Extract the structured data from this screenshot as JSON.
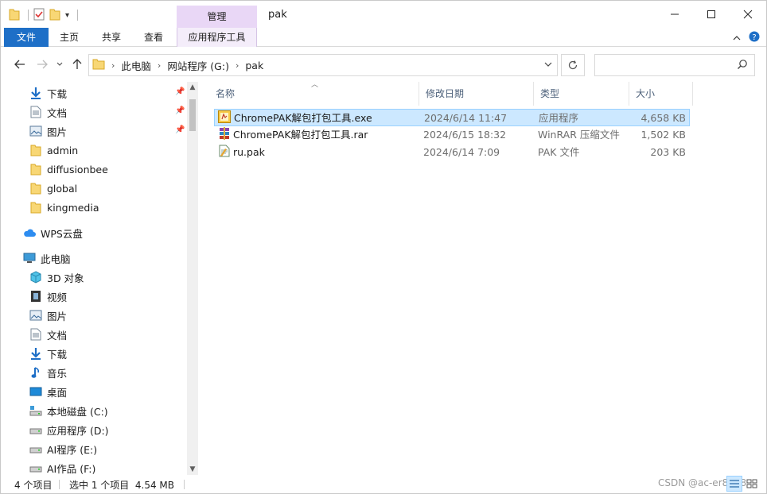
{
  "window": {
    "title": "pak"
  },
  "ribbon": {
    "context_group": "管理",
    "tabs": [
      "文件",
      "主页",
      "共享",
      "查看",
      "应用程序工具"
    ]
  },
  "address": {
    "breadcrumbs": [
      "此电脑",
      "网站程序 (G:)",
      "pak"
    ],
    "search_placeholder": ""
  },
  "nav": {
    "quick_access": [
      {
        "label": "下载",
        "icon": "download-icon",
        "pinned": true
      },
      {
        "label": "文档",
        "icon": "document-icon",
        "pinned": true
      },
      {
        "label": "图片",
        "icon": "picture-icon",
        "pinned": true
      },
      {
        "label": "admin",
        "icon": "folder-icon",
        "pinned": false
      },
      {
        "label": "diffusionbee",
        "icon": "folder-icon",
        "pinned": false
      },
      {
        "label": "global",
        "icon": "folder-icon",
        "pinned": false
      },
      {
        "label": "kingmedia",
        "icon": "folder-icon",
        "pinned": false
      }
    ],
    "wps": "WPS云盘",
    "this_pc": "此电脑",
    "pc_items": [
      {
        "label": "3D 对象",
        "icon": "cube-icon"
      },
      {
        "label": "视频",
        "icon": "video-icon"
      },
      {
        "label": "图片",
        "icon": "picture-icon"
      },
      {
        "label": "文档",
        "icon": "document-icon"
      },
      {
        "label": "下载",
        "icon": "download-icon"
      },
      {
        "label": "音乐",
        "icon": "music-icon"
      },
      {
        "label": "桌面",
        "icon": "desktop-icon"
      },
      {
        "label": "本地磁盘 (C:)",
        "icon": "system-drive-icon"
      },
      {
        "label": "应用程序 (D:)",
        "icon": "drive-icon"
      },
      {
        "label": "AI程序 (E:)",
        "icon": "drive-icon"
      },
      {
        "label": "AI作品 (F:)",
        "icon": "drive-icon"
      }
    ]
  },
  "columns": [
    "名称",
    "修改日期",
    "类型",
    "大小"
  ],
  "files": [
    {
      "name": "ChromePAK解包打包工具.exe",
      "date": "2024/6/14 11:47",
      "type": "应用程序",
      "size": "4,658 KB",
      "icon": "exe-icon",
      "selected": true
    },
    {
      "name": "ChromePAK解包打包工具.rar",
      "date": "2024/6/15 18:32",
      "type": "WinRAR 压缩文件",
      "size": "1,502 KB",
      "icon": "winrar-icon",
      "selected": false
    },
    {
      "name": "ru.pak",
      "date": "2024/6/14 7:09",
      "type": "PAK 文件",
      "size": "203 KB",
      "icon": "pak-file-icon",
      "selected": false
    }
  ],
  "status": {
    "count": "4 个项目",
    "selection": "选中 1 个项目  4.54 MB",
    "watermark": "CSDN @ac-er8888"
  },
  "colors": {
    "accent": "#1e6fc7",
    "context_tab": "#e9d7f6",
    "selection": "#cce8ff",
    "folder": "#f8d775"
  }
}
